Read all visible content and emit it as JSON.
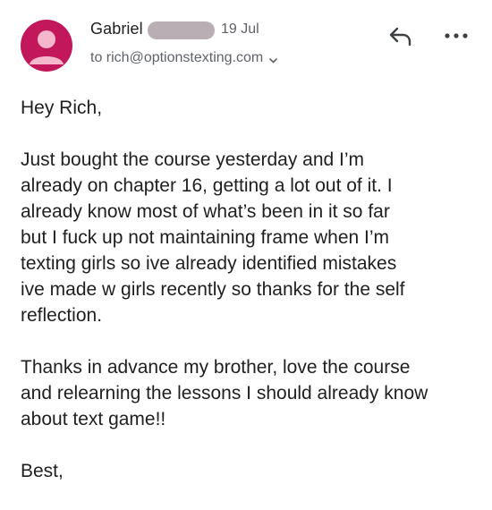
{
  "email": {
    "sender_name": "Gabriel",
    "date": "19 Jul",
    "recipient_line": "to rich@optionstexting.com",
    "avatar_color": "#c2185b",
    "redaction_color": "#b9aeb3"
  },
  "actions": {
    "reply_icon": "reply-icon",
    "more_icon": "more-options-icon"
  },
  "body": {
    "greeting": "Hey Rich,",
    "paragraph_1_lines": [
      "Just bought the course yesterday and I’m",
      "already on chapter 16, getting a lot out of it. I",
      "already know most of what’s been in it so far",
      "but I fuck up not maintaining frame when I’m",
      "texting girls so ive already identified mistakes",
      "ive made w girls recently so thanks for the self",
      "reflection."
    ],
    "paragraph_2_lines": [
      "Thanks in advance my brother, love the course",
      "and relearning the lessons I should already know",
      "about text game!!"
    ],
    "signoff": "Best,"
  }
}
